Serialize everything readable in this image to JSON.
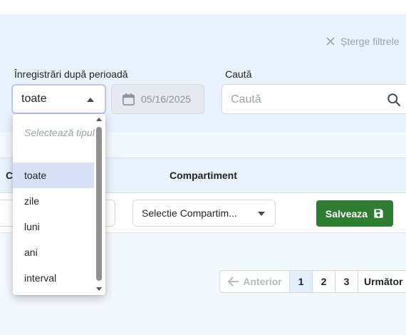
{
  "filters": {
    "clear_label": "Șterge filtrele",
    "period_label": "Înregistrări după perioadă",
    "period_value": "toate",
    "date_value": "05/16/2025",
    "search_label": "Caută",
    "search_placeholder": "Caută"
  },
  "dropdown": {
    "header": "Selectează tipul",
    "options": [
      "toate",
      "zile",
      "luni",
      "ani",
      "interval"
    ],
    "selected": "toate"
  },
  "table": {
    "columns": [
      "C",
      "Compartiment"
    ],
    "row": {
      "compartment_value": "Selectie Compartim...",
      "save_label": "Salveaza"
    }
  },
  "pagination": {
    "prev_label": "Anterior",
    "pages": [
      "1",
      "2",
      "3"
    ],
    "active_page": "1",
    "next_label": "Următor"
  },
  "colors": {
    "panel_bg": "#e9f2fc",
    "save_button": "#2e7d32",
    "selected_option": "#d8e0f8",
    "active_page": "#e3eefc"
  }
}
